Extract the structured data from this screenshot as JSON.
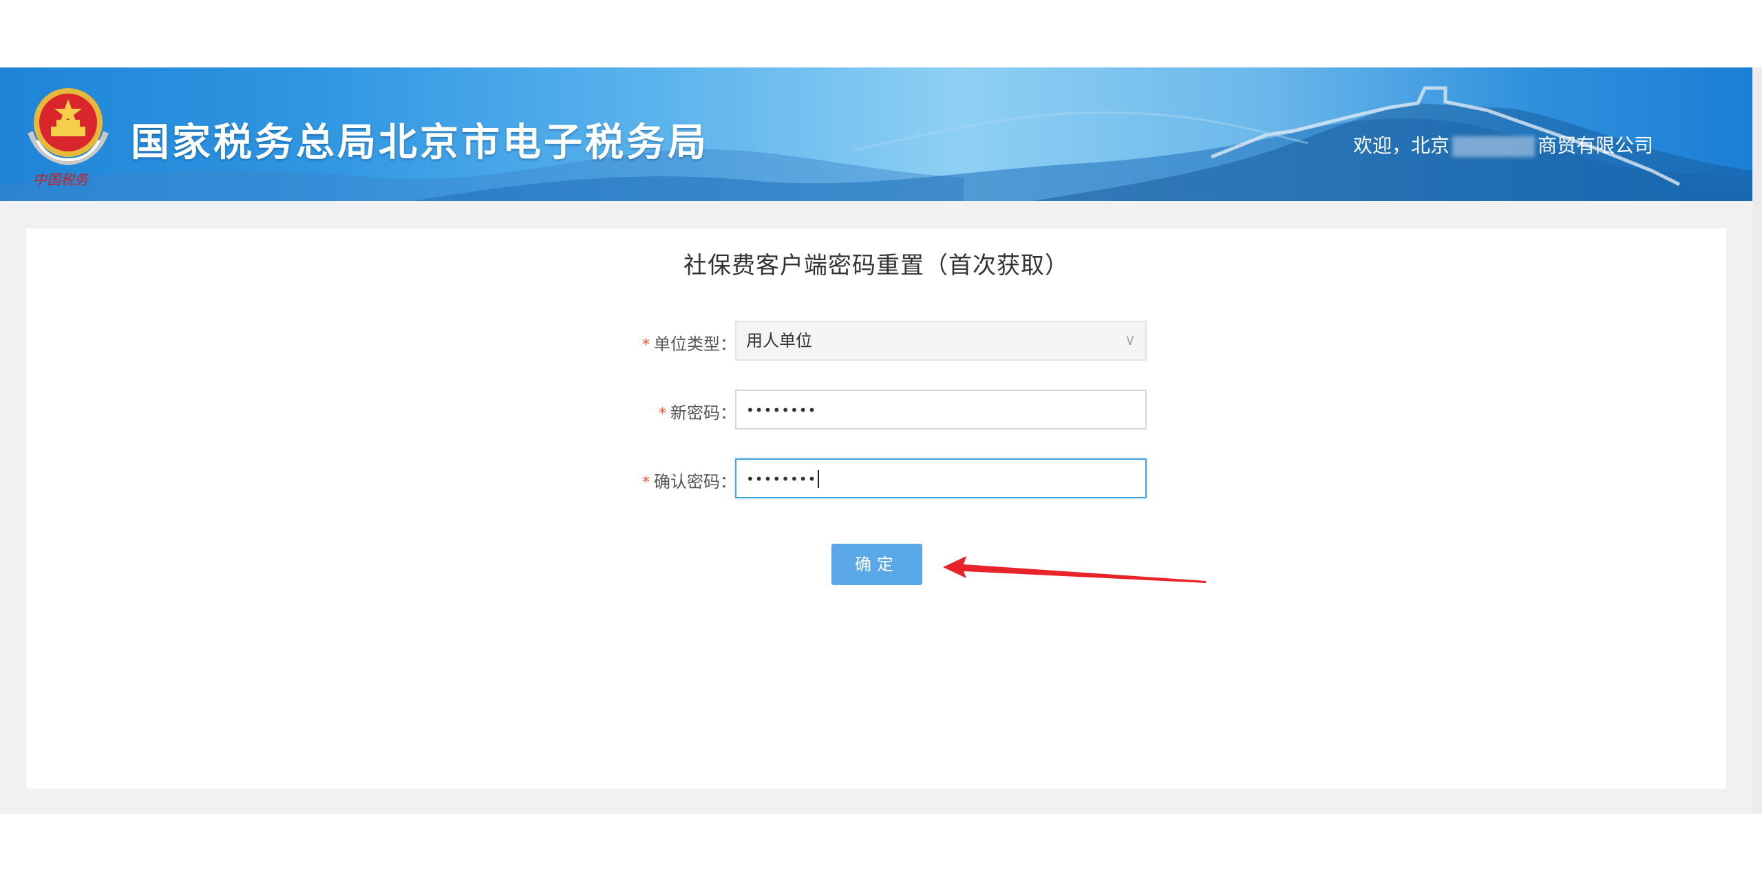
{
  "header": {
    "site_title": "国家税务总局北京市电子税务局",
    "welcome_prefix": "欢迎，北京",
    "welcome_suffix": "商贸有限公司"
  },
  "form": {
    "title": "社保费客户端密码重置（首次获取）",
    "required_mark": "*",
    "unit_type": {
      "label": "单位类型：",
      "value": "用人单位"
    },
    "new_password": {
      "label": "新密码：",
      "value": "••••••••"
    },
    "confirm_password": {
      "label": "确认密码：",
      "value": "••••••••"
    },
    "submit_label": "确定"
  },
  "icons": {
    "select_chevron": "chevron-down-icon",
    "emblem": "national-emblem-icon",
    "annotation": "red-arrow-icon"
  },
  "colors": {
    "banner_blue": "#2f96e2",
    "button_blue": "#5aa8e8",
    "required_orange": "#e8502a",
    "focus_blue": "#4a9fe0",
    "arrow_red": "#e8232a"
  }
}
